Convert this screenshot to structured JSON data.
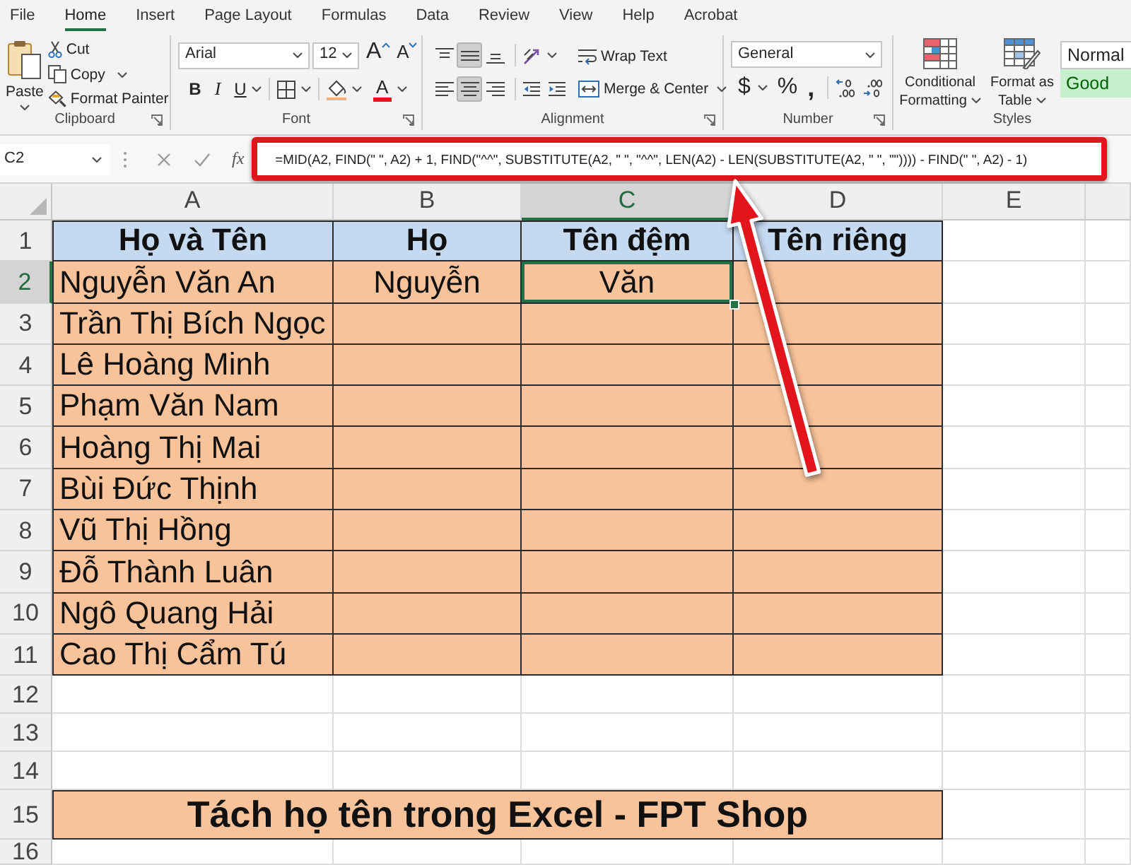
{
  "ribbon_tabs": [
    {
      "label": "File",
      "selected": false
    },
    {
      "label": "Home",
      "selected": true
    },
    {
      "label": "Insert",
      "selected": false
    },
    {
      "label": "Page Layout",
      "selected": false
    },
    {
      "label": "Formulas",
      "selected": false
    },
    {
      "label": "Data",
      "selected": false
    },
    {
      "label": "Review",
      "selected": false
    },
    {
      "label": "View",
      "selected": false
    },
    {
      "label": "Help",
      "selected": false
    },
    {
      "label": "Acrobat",
      "selected": false
    }
  ],
  "ribbon_groups": [
    {
      "kind": "clipboard",
      "label": "Clipboard",
      "dialog_launcher": true,
      "paste": "Paste",
      "cut": "Cut",
      "copy": "Copy",
      "format_painter": "Format Painter"
    },
    {
      "kind": "font",
      "label": "Font",
      "dialog_launcher": true,
      "font_name": "Arial",
      "font_size": "12",
      "grow_font": "A",
      "shrink_font": "A",
      "bold": "B",
      "italic": "I",
      "underline": "U",
      "font_color": "A"
    },
    {
      "kind": "alignment",
      "label": "Alignment",
      "dialog_launcher": true,
      "vertical_align": [
        {
          "selected": false
        },
        {
          "selected": true
        },
        {
          "selected": false
        }
      ],
      "horizontal_align": [
        {
          "selected": false
        },
        {
          "selected": true
        },
        {
          "selected": false
        }
      ],
      "wrap_text": "Wrap Text",
      "merge_center": "Merge & Center"
    },
    {
      "kind": "number",
      "label": "Number",
      "dialog_launcher": true,
      "number_format": "General",
      "currency": "$",
      "percent": "%",
      "comma": ","
    },
    {
      "kind": "styles",
      "label": "Styles",
      "dialog_launcher": false,
      "conditional_formatting": "Conditional Formatting",
      "format_as_table": "Format as Table",
      "cell_styles": [
        {
          "label": "Normal",
          "kind": "normal"
        },
        {
          "label": "Good",
          "kind": "good"
        }
      ]
    }
  ],
  "formula_bar": {
    "name_box": "C2",
    "function_label": "fx",
    "formula": "=MID(A2, FIND(\" \", A2) + 1, FIND(\"^^\", SUBSTITUTE(A2, \" \", \"^^\", LEN(A2) - LEN(SUBSTITUTE(A2, \" \", \"\")))) - FIND(\" \", A2) - 1)",
    "highlighted": true
  },
  "sheet": {
    "columns": [
      {
        "label": "A",
        "selected": false
      },
      {
        "label": "B",
        "selected": false
      },
      {
        "label": "C",
        "selected": true
      },
      {
        "label": "D",
        "selected": false
      },
      {
        "label": "E",
        "selected": false
      }
    ],
    "rows": [
      {
        "label": "1",
        "kind": "header",
        "selected": false,
        "cells": [
          "Họ và Tên",
          "Họ",
          "Tên đệm",
          "Tên riêng"
        ]
      },
      {
        "label": "2",
        "kind": "data",
        "selected": true,
        "cells": [
          "Nguyễn Văn An",
          "Nguyễn",
          "Văn"
        ]
      },
      {
        "label": "3",
        "kind": "data",
        "selected": false,
        "cells": [
          "Trần Thị Bích Ngọc"
        ]
      },
      {
        "label": "4",
        "kind": "data",
        "selected": false,
        "cells": [
          "Lê Hoàng Minh"
        ]
      },
      {
        "label": "5",
        "kind": "data",
        "selected": false,
        "cells": [
          "Phạm Văn Nam"
        ]
      },
      {
        "label": "6",
        "kind": "data",
        "selected": false,
        "cells": [
          "Hoàng Thị Mai"
        ]
      },
      {
        "label": "7",
        "kind": "data",
        "selected": false,
        "cells": [
          "Bùi Đức Thịnh"
        ]
      },
      {
        "label": "8",
        "kind": "data",
        "selected": false,
        "cells": [
          "Vũ Thị Hồng"
        ]
      },
      {
        "label": "9",
        "kind": "data",
        "selected": false,
        "cells": [
          "Đỗ Thành Luân"
        ]
      },
      {
        "label": "10",
        "kind": "data",
        "selected": false,
        "cells": [
          "Ngô Quang Hải"
        ]
      },
      {
        "label": "11",
        "kind": "data",
        "selected": false,
        "cells": [
          "Cao Thị Cẩm Tú"
        ]
      },
      {
        "label": "12",
        "kind": "empty",
        "selected": false
      },
      {
        "label": "13",
        "kind": "empty",
        "selected": false
      },
      {
        "label": "14",
        "kind": "empty",
        "selected": false
      },
      {
        "label": "15",
        "kind": "title",
        "selected": false,
        "cells": [
          "Tách họ tên trong Excel - FPT Shop"
        ]
      },
      {
        "label": "16",
        "kind": "empty",
        "selected": false
      }
    ]
  }
}
